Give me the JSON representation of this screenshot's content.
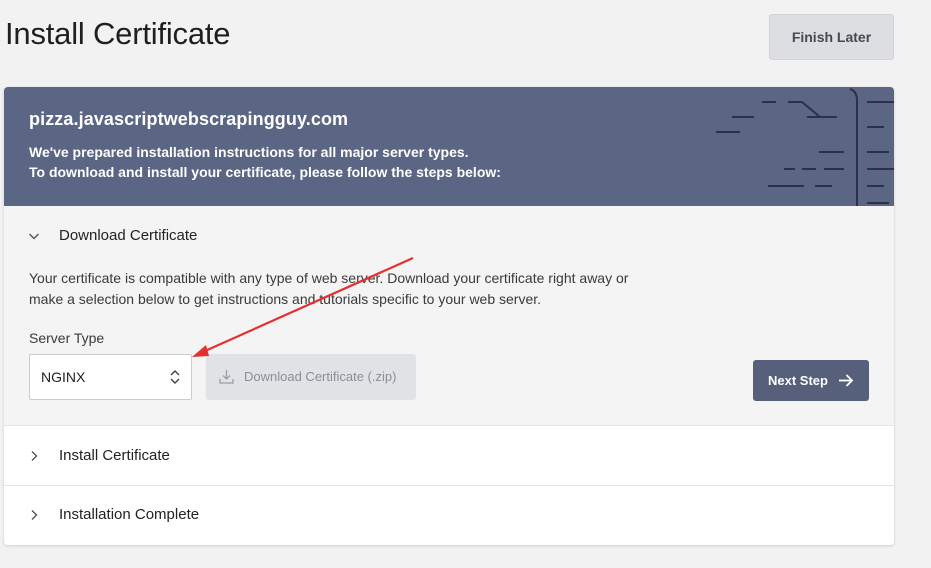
{
  "page": {
    "title": "Install Certificate",
    "finish_later": "Finish Later"
  },
  "banner": {
    "domain": "pizza.javascriptwebscrapingguy.com",
    "line1": "We've prepared installation instructions for all major server types.",
    "line2": "To download and install your certificate, please follow the steps below:"
  },
  "steps": [
    {
      "label": "Download Certificate",
      "expanded": true,
      "icon": "chevron-down-icon",
      "description": "Your certificate is compatible with any type of web server. Download your certificate right away or make a selection below to get instructions and tutorials specific to your web server.",
      "server_type_label": "Server Type",
      "server_type_value": "NGINX",
      "download_button": "Download Certificate (.zip)",
      "download_icon": "download-icon",
      "next_button": "Next Step",
      "next_icon": "arrow-right-icon"
    },
    {
      "label": "Install Certificate",
      "expanded": false,
      "icon": "chevron-right-icon"
    },
    {
      "label": "Installation Complete",
      "expanded": false,
      "icon": "chevron-right-icon"
    }
  ],
  "colors": {
    "banner_bg": "#5b6584",
    "primary_button": "#56607b",
    "annotation_arrow": "#e53030"
  }
}
